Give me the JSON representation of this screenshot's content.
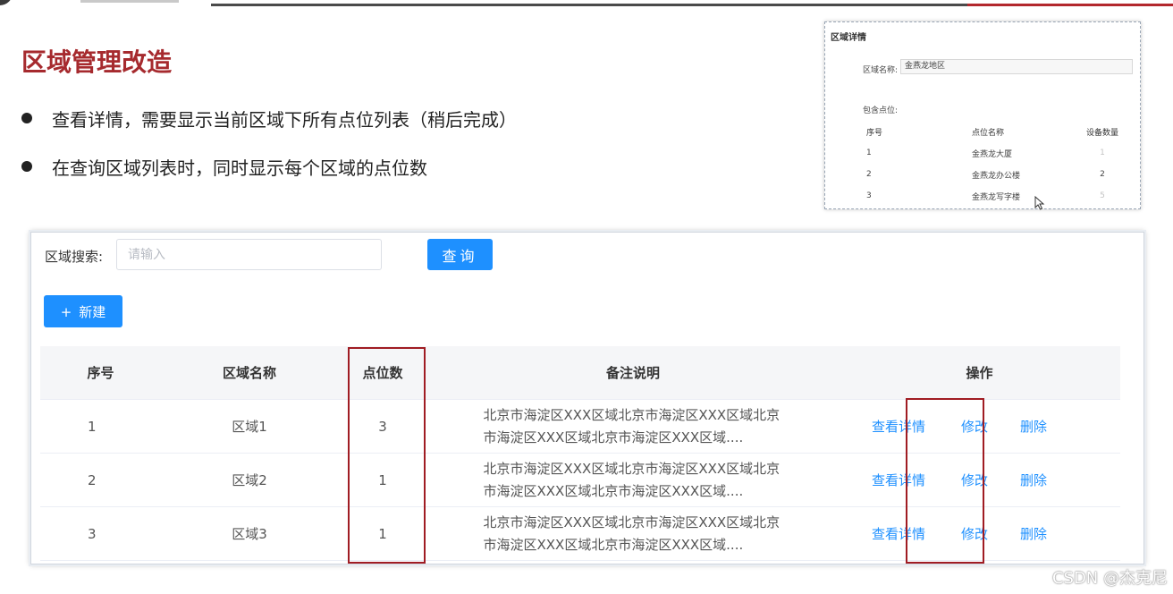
{
  "page": {
    "title": "区域管理改造",
    "bullets": [
      "查看详情，需要显示当前区域下所有点位列表（稍后完成）",
      "在查询区域列表时，同时显示每个区域的点位数"
    ],
    "watermark": "CSDN @杰克尼"
  },
  "preview": {
    "title": "区域详情",
    "name_label": "区域名称:",
    "name_value": "金燕龙地区",
    "points_label": "包含点位:",
    "headers": [
      "序号",
      "点位名称",
      "设备数量"
    ],
    "rows": [
      {
        "idx": "1",
        "name": "金燕龙大厦",
        "count": "1"
      },
      {
        "idx": "2",
        "name": "金燕龙办公楼",
        "count": "2"
      },
      {
        "idx": "3",
        "name": "金燕龙写字楼",
        "count": "5"
      }
    ]
  },
  "search": {
    "label": "区域搜索:",
    "placeholder": "请输入",
    "query_button": "查询",
    "new_button": "新建"
  },
  "table": {
    "headers": {
      "idx": "序号",
      "name": "区域名称",
      "count": "点位数",
      "note": "备注说明",
      "ops": "操作"
    },
    "rows": [
      {
        "idx": "1",
        "name": "区域1",
        "count": "3",
        "note": "北京市海淀区XXX区域北京市海淀区XXX区域北京市海淀区XXX区域北京市海淀区XXX区域...."
      },
      {
        "idx": "2",
        "name": "区域2",
        "count": "1",
        "note": "北京市海淀区XXX区域北京市海淀区XXX区域北京市海淀区XXX区域北京市海淀区XXX区域...."
      },
      {
        "idx": "3",
        "name": "区域3",
        "count": "1",
        "note": "北京市海淀区XXX区域北京市海淀区XXX区域北京市海淀区XXX区域北京市海淀区XXX区域...."
      }
    ],
    "actions": {
      "detail": "查看详情",
      "edit": "修改",
      "delete": "删除"
    }
  },
  "colors": {
    "accent": "#1e90ff",
    "title_red": "#a62a2e",
    "highlight_red": "#a01c23"
  }
}
